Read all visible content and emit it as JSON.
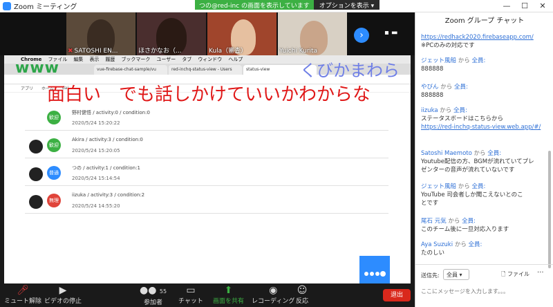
{
  "window": {
    "title": "Zoom ミーティング",
    "minimize": "—",
    "maximize": "☐",
    "close": "✕"
  },
  "share_banner": {
    "text": "つの@red-inc の画面を表示しています",
    "options_label": "オプションを表示 ▾"
  },
  "videos": [
    {
      "name": "SATOSHI EN...",
      "muted": true
    },
    {
      "name": "ほさかなお（...",
      "muted": false
    },
    {
      "name": "Kula（審査）",
      "muted": false
    },
    {
      "name": "Yuichi Kurita",
      "muted": false
    }
  ],
  "shared_screen": {
    "menu": [
      "Chrome",
      "ファイル",
      "編集",
      "表示",
      "履歴",
      "ブックマーク",
      "ユーザー",
      "タブ",
      "ウィンドウ",
      "ヘルプ"
    ],
    "tabs": [
      "vue-firebase-chat-sample/vu",
      "red-inchq-status-view - Users",
      "status-view"
    ],
    "bookmarks": [
      "アプリ",
      "ホーム",
      "dai"
    ],
    "annotations": {
      "green": "www",
      "blue": "くびかまわら",
      "red": "面白い　でも話しかけていいかわからな"
    },
    "entries": [
      {
        "badge": "歓迎",
        "badge_color": "#3cb043",
        "line1": "野村健悟 / activity:0 / condition:0",
        "line2": "2020/5/24 15:20:22",
        "has_avatar": false
      },
      {
        "badge": "歓迎",
        "badge_color": "#3cb043",
        "line1": "Akira / activity:3 / condition:0",
        "line2": "2020/5/24 15:20:05",
        "has_avatar": true
      },
      {
        "badge": "普通",
        "badge_color": "#2d8cff",
        "line1": "つの / activity:1 / condition:1",
        "line2": "2020/5/24 15:14:54",
        "has_avatar": true
      },
      {
        "badge": "無理",
        "badge_color": "#e0443a",
        "line1": "iizuka / activity:3 / condition:2",
        "line2": "2020/5/24 14:55:20",
        "has_avatar": true
      }
    ]
  },
  "toolbar": {
    "mute": "ミュート解除",
    "video": "ビデオの停止",
    "participants": "参加者",
    "participants_count": "55",
    "chat": "チャット",
    "share": "画面を共有",
    "record": "レコーディング",
    "reactions": "反応",
    "end": "退出"
  },
  "chat": {
    "title": "Zoom グループ チャット",
    "from_word": "から",
    "to_all": "全員:",
    "messages": [
      {
        "sender": "",
        "lines": [
          "https://redhack2020.firebaseapp.com/",
          "※PCのみの対応です"
        ],
        "link_first": true
      },
      {
        "sender": "ジェット風船",
        "lines": [
          "888888"
        ]
      },
      {
        "sender": "やびん",
        "lines": [
          "888888"
        ]
      },
      {
        "sender": "iizuka",
        "lines": [
          "ステータスボードはこちらから",
          "https://red-inchq-status-view.web.app/#/"
        ],
        "link_last": true
      },
      {
        "sender": "Satoshi Maemoto",
        "lines": [
          "Youtube配信の方、BGMが流れていてプレ",
          "ゼンターの音声が流れていないです"
        ]
      },
      {
        "sender": "ジェット風船",
        "lines": [
          "YouTube 司会者しか聞こえないとのこ",
          "とです"
        ]
      },
      {
        "sender": "尾石 元気",
        "lines": [
          "このチーム後に一旦対応入ります"
        ]
      },
      {
        "sender": "Aya Suzuki",
        "lines": [
          "たのしい"
        ]
      }
    ],
    "to_label": "送信先:",
    "to_value": "全員",
    "file_label": "ファイル",
    "more_label": "···",
    "input_placeholder": "ここにメッセージを入力します。。。"
  }
}
